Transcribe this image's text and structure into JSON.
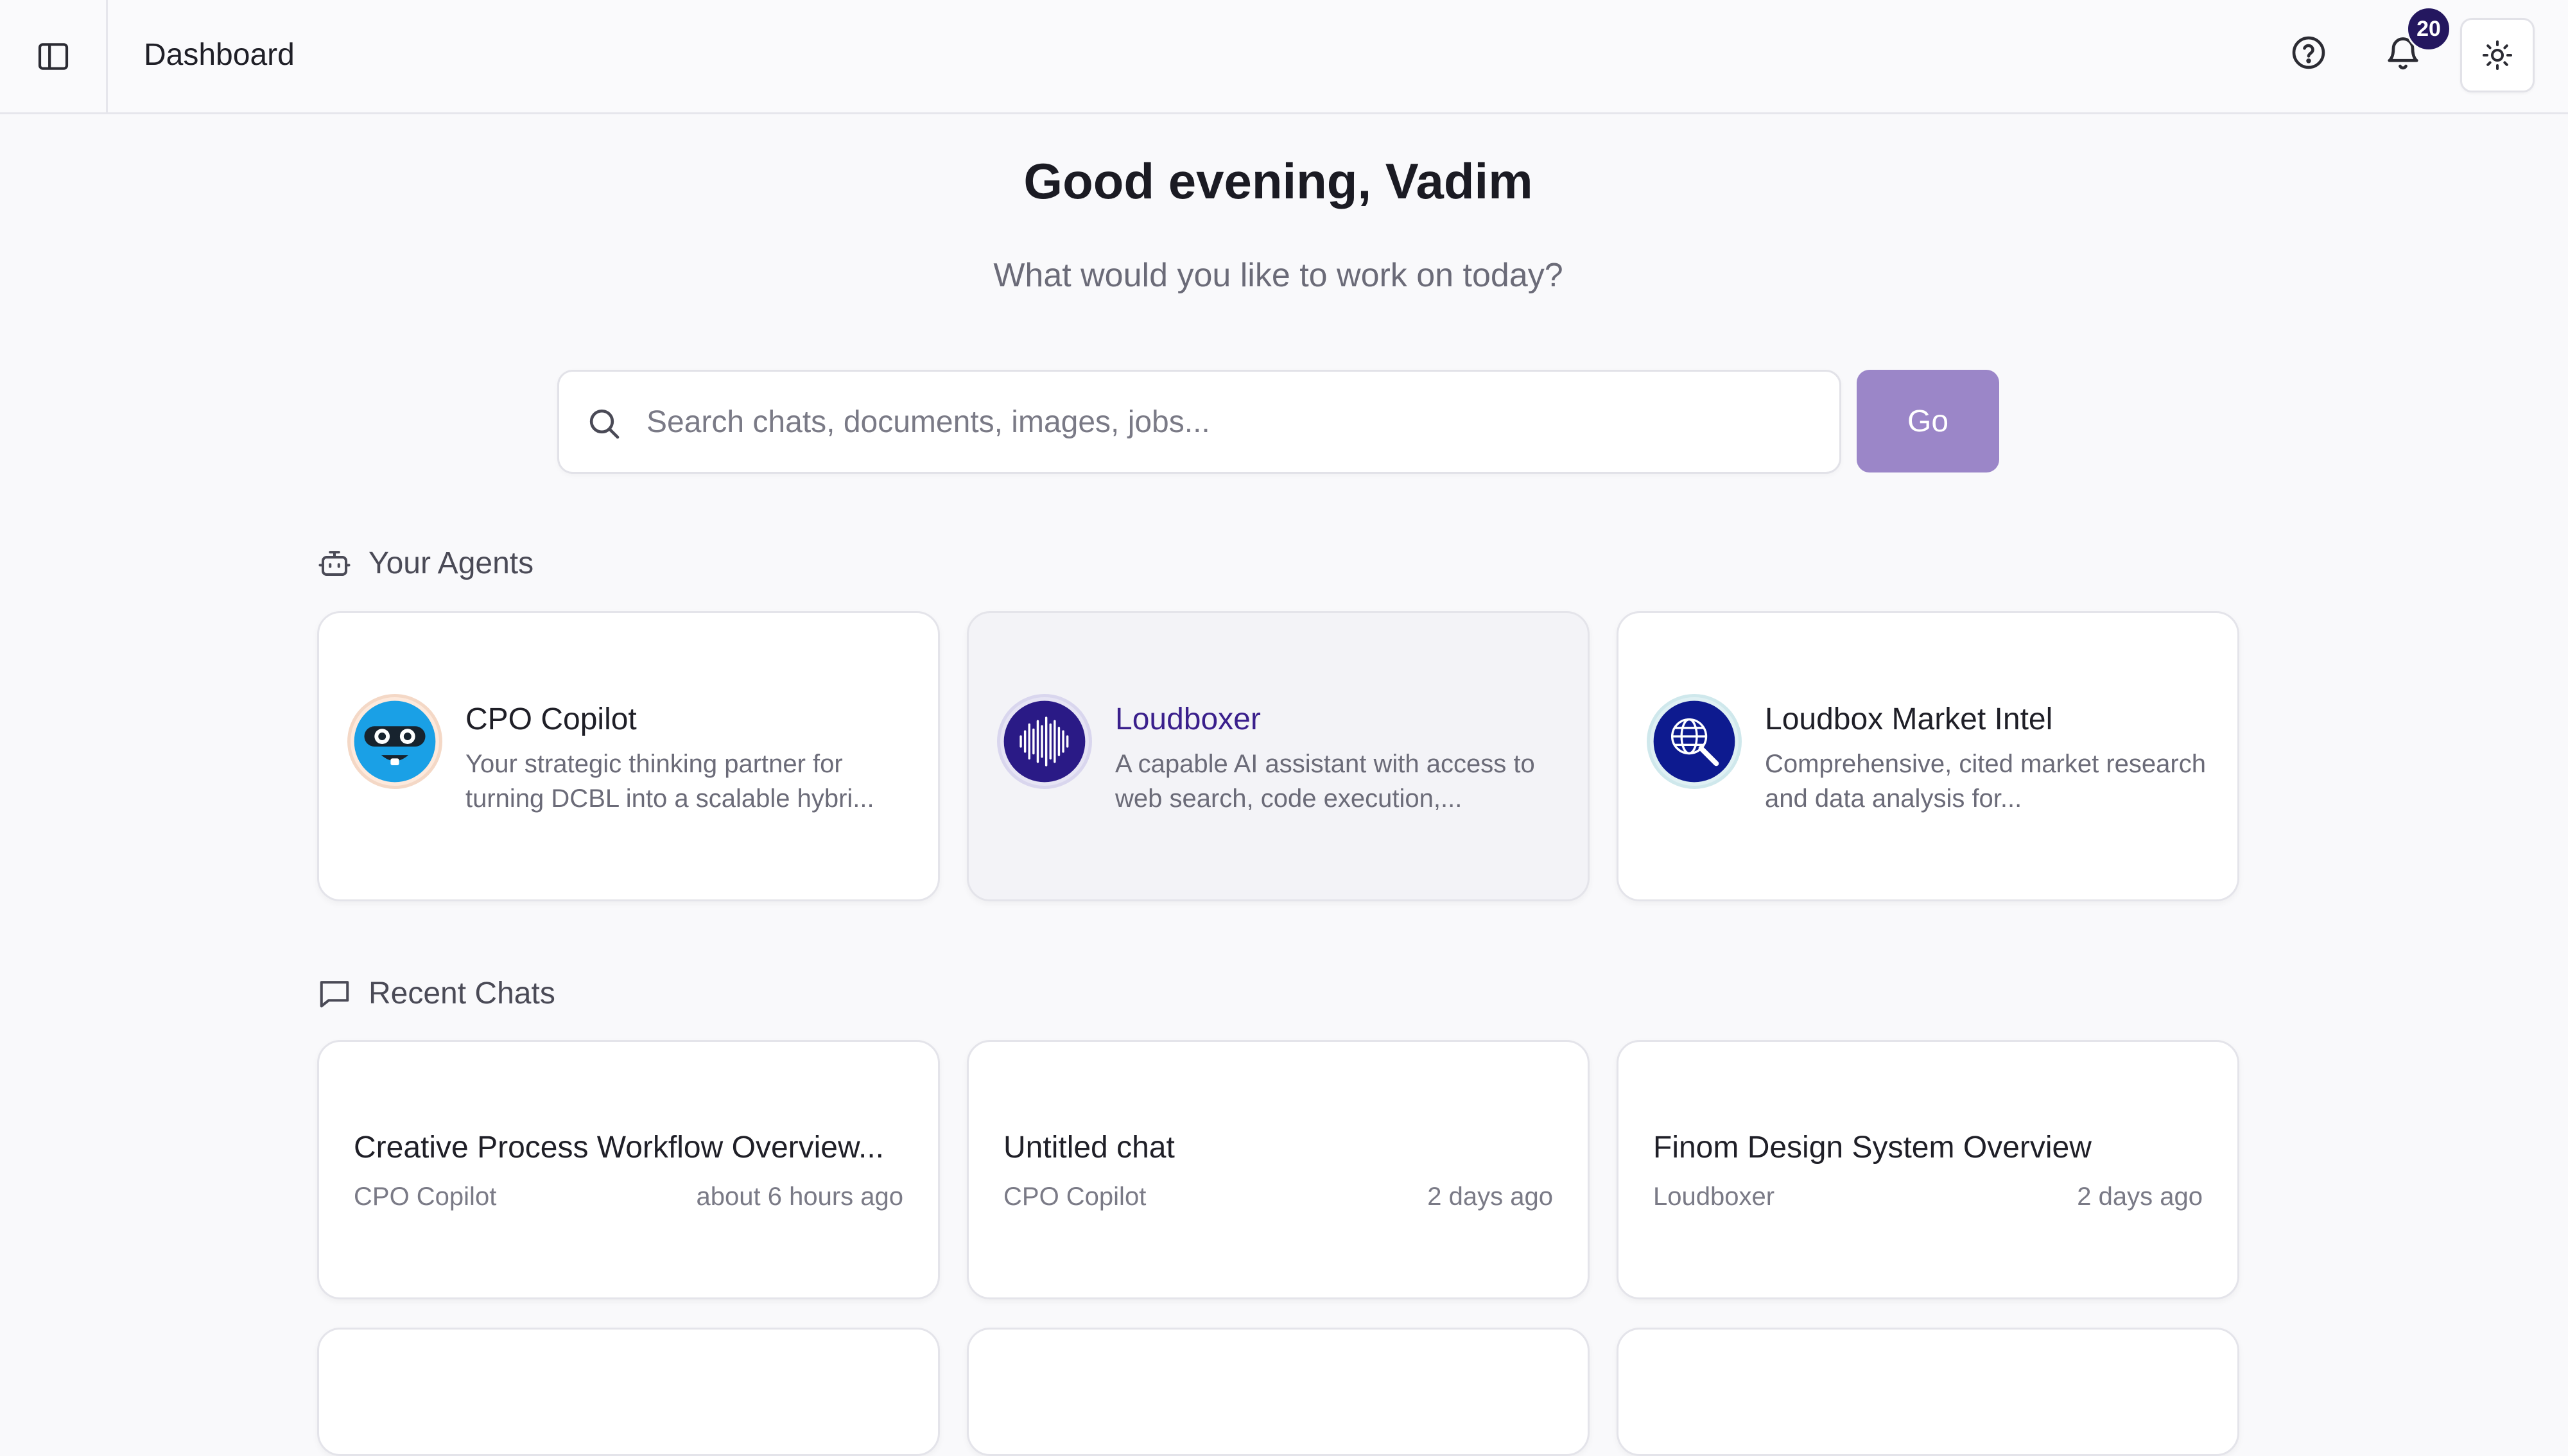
{
  "header": {
    "title": "Dashboard",
    "notification_count": "20",
    "icons": [
      "sidebar-toggle-icon",
      "help-icon",
      "bell-icon",
      "sun-icon"
    ]
  },
  "hero": {
    "greeting": "Good evening, Vadim",
    "subtitle": "What would you like to work on today?"
  },
  "search": {
    "placeholder": "Search chats, documents, images, jobs...",
    "value": "",
    "go_label": "Go"
  },
  "agents_section": {
    "label": "Your Agents",
    "items": [
      {
        "name": "CPO Copilot",
        "description": "Your strategic thinking partner for turning DCBL into a scalable hybri...",
        "avatar": "robot-face-avatar"
      },
      {
        "name": "Loudboxer",
        "description": "A capable AI assistant with access to web search, code execution,...",
        "avatar": "sound-wave-avatar"
      },
      {
        "name": "Loudbox Market Intel",
        "description": "Comprehensive, cited market research and data analysis for...",
        "avatar": "globe-magnifier-avatar"
      }
    ]
  },
  "chats_section": {
    "label": "Recent Chats",
    "items": [
      {
        "title": "Creative Process Workflow Overview...",
        "agent": "CPO Copilot",
        "time": "about 6 hours ago"
      },
      {
        "title": "Untitled chat",
        "agent": "CPO Copilot",
        "time": "2 days ago"
      },
      {
        "title": "Finom Design System Overview",
        "agent": "Loudboxer",
        "time": "2 days ago"
      }
    ]
  },
  "colors": {
    "accent": "#9b86c8",
    "badge": "#24175f",
    "active_agent_name": "#3a1f8c",
    "avatar_blue": "#1aa0e6",
    "avatar_purple": "#2a1a86",
    "avatar_navy": "#0d1a8f"
  }
}
